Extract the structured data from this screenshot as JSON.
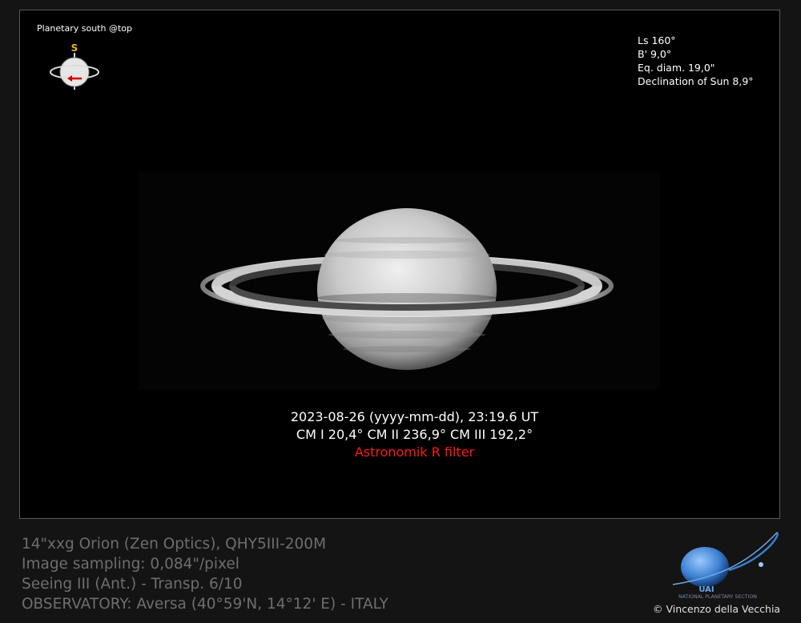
{
  "orientation": {
    "label": "Planetary south @top",
    "pole_letter": "S"
  },
  "parameters": [
    "Ls 160°",
    "B' 9,0°",
    "Eq. diam. 19,0\"",
    "Declination of Sun 8,9°"
  ],
  "caption": {
    "datetime": "2023-08-26 (yyyy-mm-dd), 23:19.6 UT",
    "central_meridians": "CM I  20,4° CM II 236,9° CM III 192,2°",
    "filter": "Astronomik R filter"
  },
  "equipment": [
    "14\"xxg Orion (Zen Optics), QHY5III-200M",
    "Image sampling:   0,084\"/pixel",
    "Seeing III (Ant.) - Transp. 6/10",
    "OBSERVATORY: Aversa (40°59'N, 14°12' E) - ITALY"
  ],
  "logo": {
    "acronym": "UAI",
    "section": "NATIONAL PLANETARY SECTION"
  },
  "credit": "© Vincenzo  della Vecchia",
  "colors": {
    "background": "#141414",
    "frame": "#000000",
    "filter_text": "#ff1a1a",
    "pole_letter": "#f2b01e",
    "logo_blue": "#3a7fd0"
  }
}
